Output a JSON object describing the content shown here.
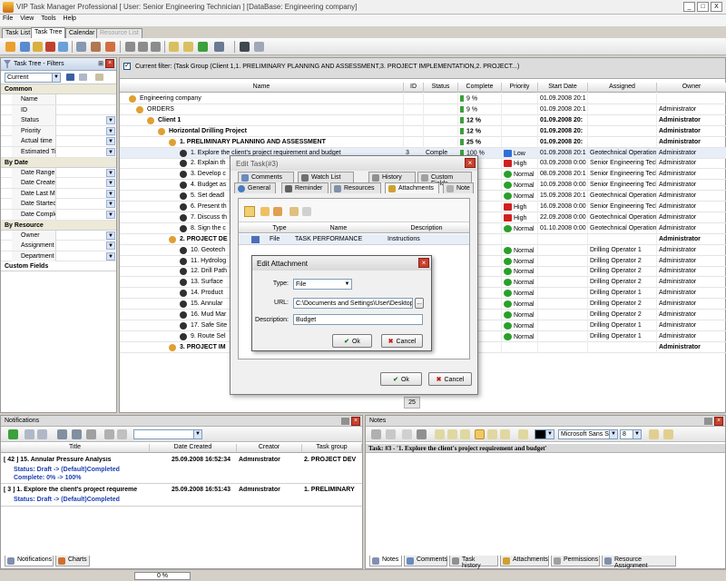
{
  "window": {
    "title": "VIP Task Manager Professional [ User: Senior Engineering Technician ] [DataBase: Engineering company]",
    "minimize": "_",
    "restore": "□",
    "close": "X"
  },
  "menu": [
    "File",
    "View",
    "Tools",
    "Help"
  ],
  "view_tabs": [
    "Task List",
    "Task Tree",
    "Calendar",
    "Resource List"
  ],
  "filter_panel": {
    "title": "Task Tree - Filters",
    "current": "Current",
    "sections": {
      "common": "Common",
      "by_date": "By Date",
      "by_resource": "By Resource",
      "custom": "Custom Fields"
    },
    "common_fields": [
      "Name",
      "ID",
      "Status",
      "Priority",
      "Actual time",
      "Estimated Ti"
    ],
    "date_fields": [
      "Date Range",
      "Date Create",
      "Date Last M",
      "Date Startec",
      "Date Comple"
    ],
    "resource_fields": [
      "Owner",
      "Assignment",
      "Department"
    ]
  },
  "grid": {
    "current_filter": "Current filter:  (Task Group  (Client 1,1. PRELIMINARY PLANNING AND ASSESSMENT,3. PROJECT IMPLEMENTATION,2. PROJECT...)",
    "columns": [
      "Name",
      "ID",
      "Status",
      "Complete",
      "Priority",
      "Start Date",
      "Assigned",
      "Owner"
    ],
    "rows": [
      {
        "name": "Engineering company",
        "id": "",
        "status": "",
        "complete": "9 %",
        "priority": "",
        "start": "01.09.2008 20:1",
        "assigned": "",
        "owner": "",
        "bold": false
      },
      {
        "name": "ORDERS",
        "id": "",
        "status": "",
        "complete": "9 %",
        "priority": "",
        "start": "01.09.2008 20:1",
        "assigned": "",
        "owner": "Administrator",
        "bold": false
      },
      {
        "name": "Client 1",
        "id": "",
        "status": "",
        "complete": "12 %",
        "priority": "",
        "start": "01.09.2008 20:",
        "assigned": "",
        "owner": "Administrator",
        "bold": true
      },
      {
        "name": "Horizontal Drilling Project",
        "id": "",
        "status": "",
        "complete": "12 %",
        "priority": "",
        "start": "01.09.2008 20:",
        "assigned": "",
        "owner": "Administrator",
        "bold": true
      },
      {
        "name": "1. PRELIMINARY PLANNING AND ASSESSMENT",
        "id": "",
        "status": "",
        "complete": "25 %",
        "priority": "",
        "start": "01.09.2008 20:",
        "assigned": "",
        "owner": "Administrator",
        "bold": true
      },
      {
        "name": "1. Explore the client's project requirement and budget",
        "id": "3",
        "status": "Comple",
        "complete": "100 %",
        "priority": "Low",
        "start": "01.09.2008 20:1",
        "assigned": "Geotechnical Operations",
        "owner": "Administrator",
        "bold": false
      },
      {
        "name": "2. Explain th",
        "id": "",
        "status": "",
        "complete": "%",
        "priority": "High",
        "start": "03.09.2008 0:00",
        "assigned": "Senior Engineering Tech",
        "owner": "Administrator",
        "bold": false
      },
      {
        "name": "3. Develop c",
        "id": "",
        "status": "",
        "complete": "%",
        "priority": "Normal",
        "start": "08.09.2008 20:1",
        "assigned": "Senior Engineering Tech",
        "owner": "Administrator",
        "bold": false
      },
      {
        "name": "4. Budget as",
        "id": "",
        "status": "",
        "complete": "%",
        "priority": "Normal",
        "start": "10.09.2008 0:00",
        "assigned": "Senior Engineering Tech",
        "owner": "Administrator",
        "bold": false
      },
      {
        "name": "5. Set deadl",
        "id": "",
        "status": "",
        "complete": "%",
        "priority": "Normal",
        "start": "15.09.2008 20:1",
        "assigned": "Geotechnical Operations",
        "owner": "Administrator",
        "bold": false
      },
      {
        "name": "6. Present th",
        "id": "",
        "status": "",
        "complete": "%",
        "priority": "High",
        "start": "16.09.2008 0:00",
        "assigned": "Senior Engineering Tech",
        "owner": "Administrator",
        "bold": false
      },
      {
        "name": "7. Discuss th",
        "id": "",
        "status": "",
        "complete": "%",
        "priority": "High",
        "start": "22.09.2008 0:00",
        "assigned": "Geotechnical Operations",
        "owner": "Administrator",
        "bold": false
      },
      {
        "name": "8. Sign the c",
        "id": "",
        "status": "",
        "complete": "%",
        "priority": "Normal",
        "start": "01.10.2008 0:00",
        "assigned": "Geotechnical Operations",
        "owner": "Administrator",
        "bold": false
      },
      {
        "name": "2. PROJECT DE",
        "id": "",
        "status": "",
        "complete": "%",
        "priority": "",
        "start": "",
        "assigned": "",
        "owner": "Administrator",
        "bold": true
      },
      {
        "name": "10. Geotech",
        "id": "",
        "status": "",
        "complete": "%",
        "priority": "Normal",
        "start": "",
        "assigned": "Drilling Operator 1",
        "owner": "Administrator",
        "bold": false
      },
      {
        "name": "11. Hydrolog",
        "id": "",
        "status": "",
        "complete": "%",
        "priority": "Normal",
        "start": "",
        "assigned": "Drilling Operator 2",
        "owner": "Administrator",
        "bold": false
      },
      {
        "name": "12. Drill Path",
        "id": "",
        "status": "",
        "complete": "%",
        "priority": "Normal",
        "start": "",
        "assigned": "Drilling Operator 2",
        "owner": "Administrator",
        "bold": false
      },
      {
        "name": "13. Surface",
        "id": "",
        "status": "",
        "complete": "%",
        "priority": "Normal",
        "start": "",
        "assigned": "Drilling Operator 2",
        "owner": "Administrator",
        "bold": false
      },
      {
        "name": "14. Product",
        "id": "",
        "status": "",
        "complete": "%",
        "priority": "Normal",
        "start": "",
        "assigned": "Drilling Operator 1",
        "owner": "Administrator",
        "bold": false
      },
      {
        "name": "15. Annular",
        "id": "",
        "status": "",
        "complete": "%",
        "priority": "Normal",
        "start": "",
        "assigned": "Drilling Operator 2",
        "owner": "Administrator",
        "bold": false
      },
      {
        "name": "16. Mud Mar",
        "id": "",
        "status": "",
        "complete": "%",
        "priority": "Normal",
        "start": "",
        "assigned": "Drilling Operator 2",
        "owner": "Administrator",
        "bold": false
      },
      {
        "name": "17. Safe Site",
        "id": "",
        "status": "",
        "complete": "%",
        "priority": "Normal",
        "start": "",
        "assigned": "Drilling Operator 1",
        "owner": "Administrator",
        "bold": false
      },
      {
        "name": "9. Route Sel",
        "id": "",
        "status": "",
        "complete": "%",
        "priority": "Normal",
        "start": "",
        "assigned": "Drilling Operator 1",
        "owner": "Administrator",
        "bold": false
      },
      {
        "name": "3. PROJECT IM",
        "id": "",
        "status": "",
        "complete": "%",
        "priority": "",
        "start": "",
        "assigned": "",
        "owner": "Administrator",
        "bold": true
      }
    ],
    "footer_value": "25"
  },
  "edit_task": {
    "title": "Edit Task(#3)",
    "tabs_top": [
      "Comments",
      "Watch List",
      "History",
      "Custom Fields"
    ],
    "tabs_bottom": [
      "General",
      "Reminder",
      "Resources",
      "Attachments",
      "Note"
    ],
    "att_columns": [
      "Type",
      "Name",
      "Description"
    ],
    "att_row": {
      "type": "File",
      "name": "TASK PERFORMANCE",
      "description": "Instructions"
    },
    "ok": "Ok",
    "cancel": "Cancel"
  },
  "edit_attachment": {
    "title": "Edit Attachment",
    "type_label": "Type:",
    "type_value": "File",
    "url_label": "URL:",
    "url_value": "C:\\Documents and Settings\\User\\Desktop",
    "url_browse": "...",
    "desc_label": "Description:",
    "desc_value": "Budget",
    "ok": "Ok",
    "cancel": "Cancel"
  },
  "notifications": {
    "title": "Notifications",
    "columns": [
      "Title",
      "Date Created",
      "Creator",
      "Task group"
    ],
    "rows": [
      {
        "title": "[ 42 ] 15. Annular Pressure Analysis",
        "date": "25.09.2008 16:52:34",
        "creator": "Administrator",
        "group": "2. PROJECT DEV",
        "status": "Status: Draft -> (Default)Completed",
        "complete": "Complete: 0% -> 100%"
      },
      {
        "title": "[ 3 ] 1. Explore the client's project requireme",
        "date": "25.09.2008 16:51:43",
        "creator": "Administrator",
        "group": "1. PRELIMINARY",
        "status": "Status: Draft -> (Default)Completed",
        "complete": ""
      }
    ],
    "tabs": [
      "Notifications",
      "Charts"
    ]
  },
  "notes": {
    "title": "Notes",
    "font_name": "Microsoft Sans S",
    "font_size": "8",
    "task_header": "Task: #3 - '1. Explore the client's project requirement and budget'",
    "tabs": [
      "Notes",
      "Comments",
      "Task history",
      "Attachments",
      "Permissions",
      "Resource Assignment"
    ]
  },
  "status_bar": {
    "progress": "0 %"
  },
  "colors": {
    "progress_green": "#3ca03c",
    "priority_low": "#2f6fd6",
    "priority_high": "#d02020",
    "priority_normal": "#2aa02a",
    "header_blue": "#c8d6ea"
  }
}
